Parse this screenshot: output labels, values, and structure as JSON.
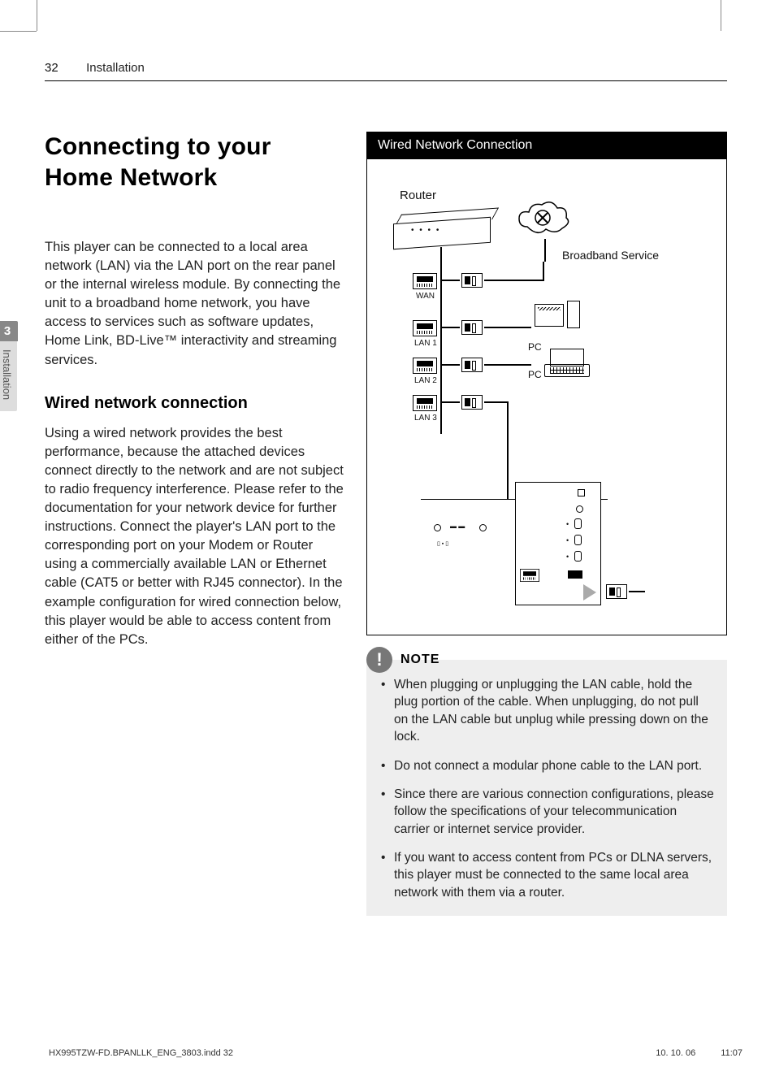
{
  "header": {
    "page_number": "32",
    "section": "Installation"
  },
  "sidetab": {
    "number": "3",
    "label": "Installation"
  },
  "title": "Connecting to your Home Network",
  "intro": "This player can be connected to a local area network (LAN) via the LAN port on the rear panel or the internal wireless module. By connecting the unit to a broadband home network, you have access to services such as software updates, Home Link, BD-Live™ interactivity and streaming services.",
  "subheading": "Wired network connection",
  "body": "Using a wired network provides the best performance, because the attached devices connect directly to the network and are not subject to radio frequency interference. Please refer to the documentation for your network device for further instructions. Connect the player's LAN port to the corresponding port on your Modem or Router using a commercially available LAN or Ethernet cable (CAT5 or better with RJ45 connector). In the example configuration for wired connection below, this player would be able to access content from either of the PCs.",
  "diagram": {
    "title": "Wired Network Connection",
    "labels": {
      "router": "Router",
      "broadband": "Broadband Service",
      "wan": "WAN",
      "lan1": "LAN 1",
      "lan2": "LAN 2",
      "lan3": "LAN 3",
      "pc1": "PC",
      "pc2": "PC"
    }
  },
  "note": {
    "title": "NOTE",
    "items": [
      "When plugging or unplugging the LAN cable, hold the plug portion of the cable. When unplugging, do not pull on the LAN cable but unplug while pressing down on the lock.",
      "Do not connect a modular phone cable to the LAN port.",
      "Since there are various connection configurations, please follow the specifications of your telecommunication carrier or internet service provider.",
      "If you want to access content from PCs or DLNA servers, this player must be connected to the same local area network with them via a router."
    ]
  },
  "footer": {
    "file": "HX995TZW-FD.BPANLLK_ENG_3803.indd   32",
    "date": "10. 10. 06",
    "time": "11:07"
  }
}
